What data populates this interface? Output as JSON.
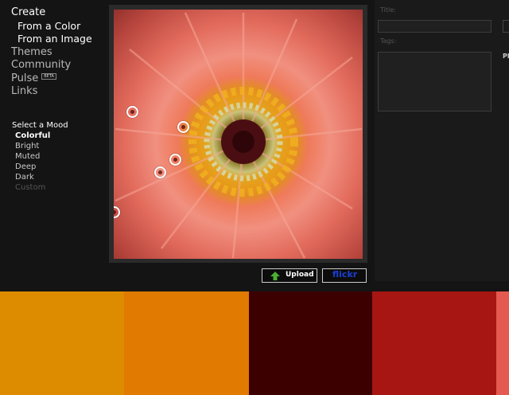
{
  "nav": {
    "create": "Create",
    "from_color": "From a Color",
    "from_image": "From an Image",
    "themes": "Themes",
    "community": "Community",
    "pulse": "Pulse",
    "beta": "BETA",
    "links": "Links"
  },
  "mood": {
    "title": "Select a Mood",
    "items": [
      "Colorful",
      "Bright",
      "Muted",
      "Deep",
      "Dark",
      "Custom"
    ],
    "selected": "Colorful"
  },
  "buttons": {
    "upload": "Upload",
    "flickr": "flickr"
  },
  "form": {
    "title_label": "Title:",
    "title_value": "",
    "tags_label": "Tags:",
    "tags_value": "",
    "cutoff_text": "Pl"
  },
  "swatches": [
    {
      "color": "#DD8C00"
    },
    {
      "color": "#E07A00"
    },
    {
      "color": "#3C0000"
    },
    {
      "color": "#A71612"
    },
    {
      "color": "#E45A50"
    }
  ],
  "icons": {
    "upload": "green-up-arrow-icon",
    "picker": "color-picker-circle-icon"
  }
}
